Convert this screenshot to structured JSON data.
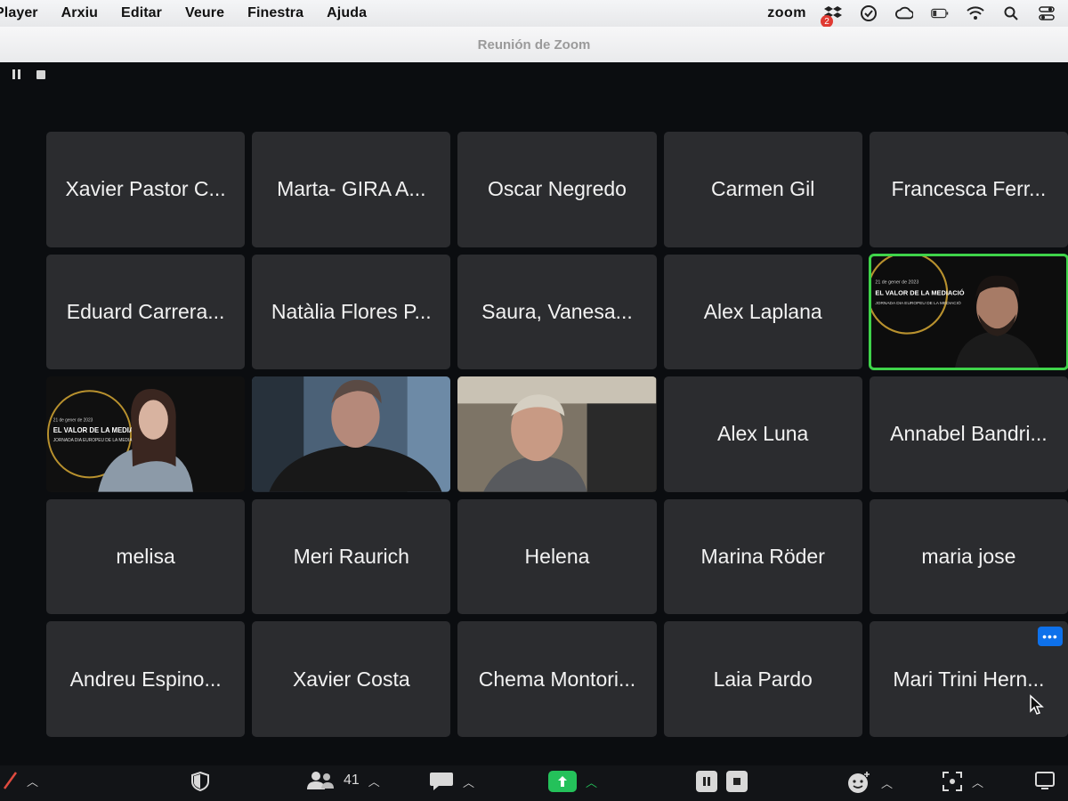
{
  "menubar": {
    "items": [
      "Player",
      "Arxiu",
      "Editar",
      "Veure",
      "Finestra",
      "Ajuda"
    ],
    "status": {
      "zoom_label": "zoom",
      "dropbox_badge": "2"
    }
  },
  "window": {
    "title": "Reunión de Zoom"
  },
  "tiles": [
    {
      "name": "Xavier Pastor C..."
    },
    {
      "name": "Marta- GIRA A..."
    },
    {
      "name": "Oscar Negredo"
    },
    {
      "name": "Carmen Gil"
    },
    {
      "name": "Francesca Ferr..."
    },
    {
      "name": "Eduard Carrera..."
    },
    {
      "name": "Natàlia Flores P..."
    },
    {
      "name": "Saura, Vanesa..."
    },
    {
      "name": "Alex Laplana"
    },
    {
      "name": "",
      "video": true,
      "active": true,
      "slide_title": "EL VALOR DE LA MEDIACIÓ",
      "slide_date": "21 de gener de 2023",
      "slide_sub": "JORNADA DIA EUROPEU DE LA MEDIACIÓ"
    },
    {
      "name": "",
      "video": true,
      "slide_title": "EL VALOR DE LA MEDIACIÓ",
      "slide_date": "21 de gener de 2023",
      "slide_sub": "JORNADA DIA EUROPEU DE LA MEDIACIÓ"
    },
    {
      "name": "",
      "video": true
    },
    {
      "name": "",
      "video": true
    },
    {
      "name": "Alex Luna"
    },
    {
      "name": "Annabel Bandri..."
    },
    {
      "name": "melisa"
    },
    {
      "name": "Meri Raurich"
    },
    {
      "name": "Helena"
    },
    {
      "name": "Marina Röder"
    },
    {
      "name": "maria jose"
    },
    {
      "name": "Andreu Espino..."
    },
    {
      "name": "Xavier Costa"
    },
    {
      "name": "Chema Montori..."
    },
    {
      "name": "Laia Pardo"
    },
    {
      "name": "Mari Trini Hern...",
      "more_label": "•••"
    }
  ],
  "toolbar": {
    "participants_count": "41"
  },
  "colors": {
    "active_speaker": "#3fd34a",
    "share": "#24c15a",
    "accent": "#0e71eb"
  }
}
